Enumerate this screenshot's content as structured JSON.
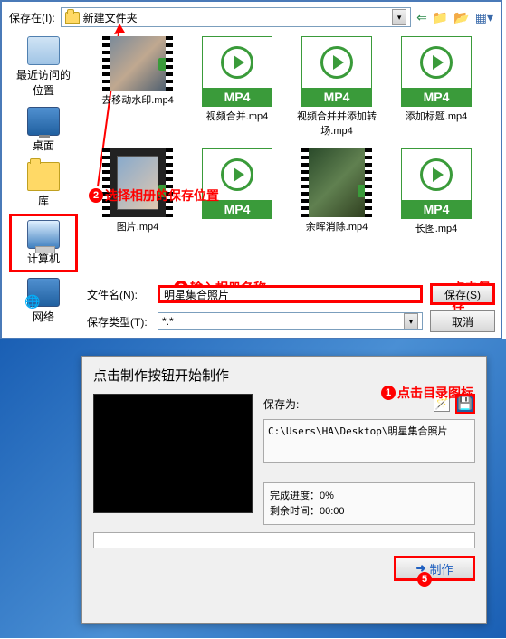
{
  "top": {
    "save_in_label": "保存在(I):",
    "folder_name": "新建文件夹",
    "sidebar": [
      {
        "label": "最近访问的位置"
      },
      {
        "label": "桌面"
      },
      {
        "label": "库"
      },
      {
        "label": "计算机"
      },
      {
        "label": "网络"
      }
    ],
    "row1": [
      {
        "name": "去移动水印.mp4",
        "type": "video"
      },
      {
        "name": "视频合并.mp4",
        "type": "mp4"
      },
      {
        "name": "视频合并并添加转场.mp4",
        "type": "mp4"
      },
      {
        "name": "添加标题.mp4",
        "type": "mp4"
      }
    ],
    "row2": [
      {
        "name": "图片.mp4",
        "type": "pic"
      },
      {
        "name": "",
        "type": "mp4"
      },
      {
        "name": "余晖消除.mp4",
        "type": "video2"
      },
      {
        "name": "长图.mp4",
        "type": "mp4"
      }
    ],
    "filename_label": "文件名(N):",
    "filename_value": "明星集合照片",
    "filetype_label": "保存类型(T):",
    "filetype_value": "*.*",
    "save_btn": "保存(S)",
    "cancel_btn": "取消",
    "ann2": "选择相册的保存位置",
    "ann3": "输入相册名称",
    "ann4": "点击保存",
    "mp4_badge": "MP4"
  },
  "bottom": {
    "title": "点击制作按钮开始制作",
    "save_as": "保存为:",
    "path": "C:\\Users\\HA\\Desktop\\明星集合照片",
    "progress_label": "完成进度：",
    "progress_value": "0%",
    "remain_label": "剩余时间：",
    "remain_value": "00:00",
    "make_btn": "制作",
    "ann1": "点击目录图标"
  }
}
